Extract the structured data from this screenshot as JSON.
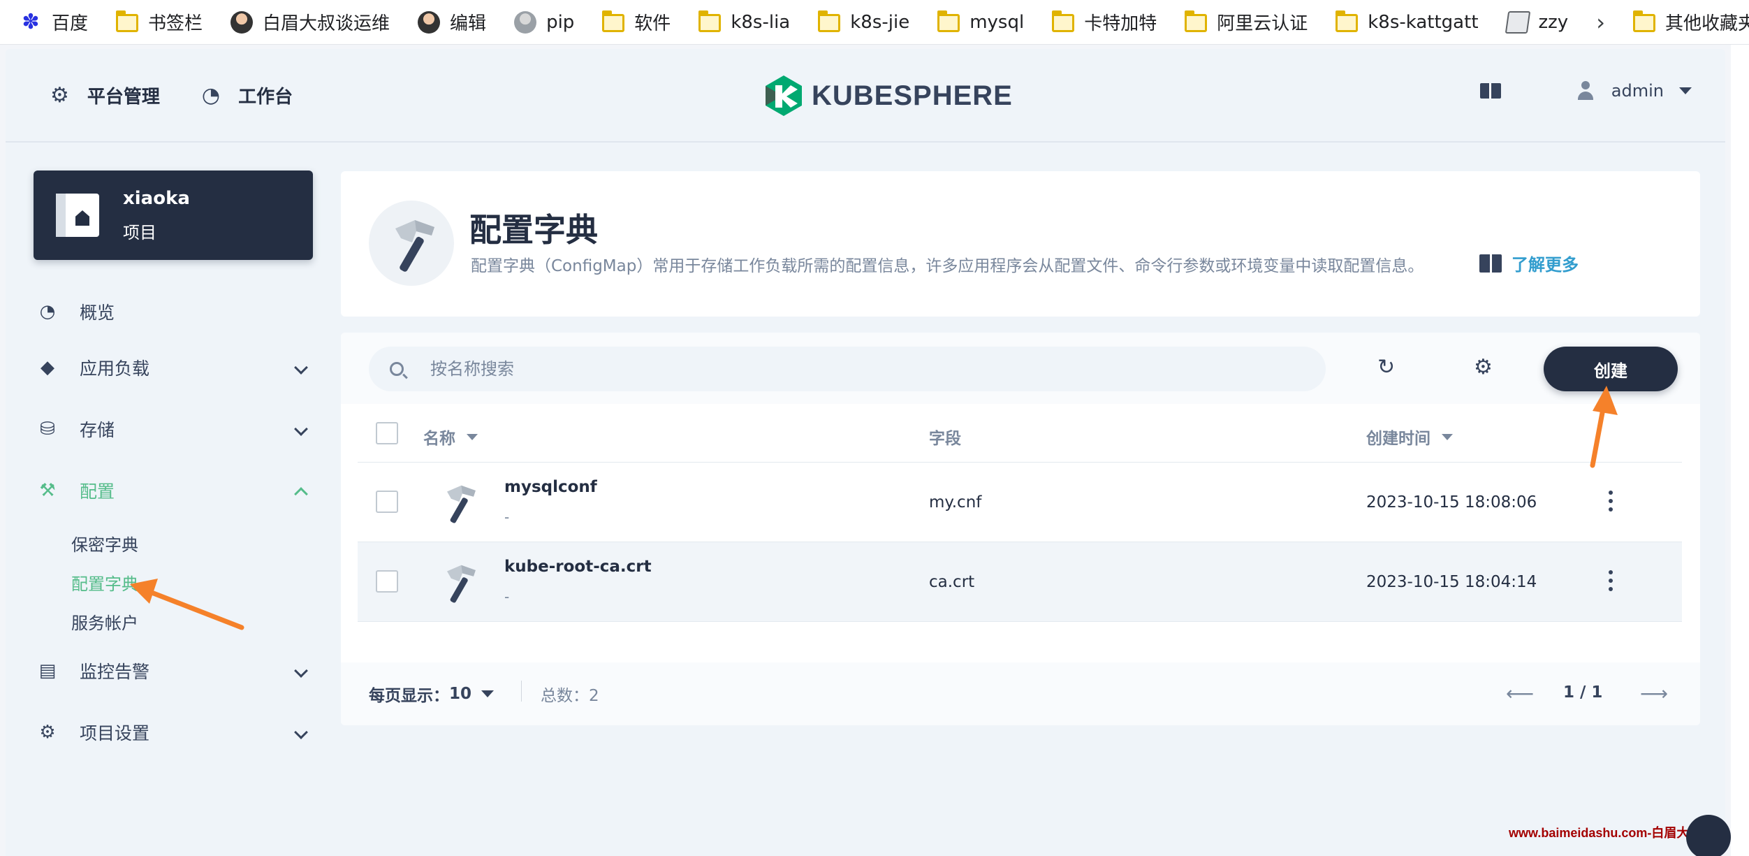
{
  "bookmarks": {
    "items": [
      {
        "label": "百度",
        "icon": "baidu-paw-icon"
      },
      {
        "label": "书签栏",
        "icon": "folder-icon"
      },
      {
        "label": "白眉大叔谈运维",
        "icon": "person-icon"
      },
      {
        "label": "编辑",
        "icon": "person-icon"
      },
      {
        "label": "pip",
        "icon": "person-icon"
      },
      {
        "label": "软件",
        "icon": "folder-icon"
      },
      {
        "label": "k8s-lia",
        "icon": "folder-icon"
      },
      {
        "label": "k8s-jie",
        "icon": "folder-icon"
      },
      {
        "label": "mysql",
        "icon": "folder-icon"
      },
      {
        "label": "卡特加特",
        "icon": "folder-icon"
      },
      {
        "label": "阿里云认证",
        "icon": "folder-icon"
      },
      {
        "label": "k8s-kattgatt",
        "icon": "folder-icon"
      },
      {
        "label": "zzy",
        "icon": "document-icon"
      }
    ],
    "other": "其他收藏夹"
  },
  "topnav": {
    "platform": "平台管理",
    "workbench": "工作台",
    "logo_text": "KUBESPHERE",
    "username": "admin"
  },
  "sidebar": {
    "project_name": "xiaoka",
    "project_type": "项目",
    "items": [
      {
        "label": "概览",
        "icon": "dashboard-icon"
      },
      {
        "label": "应用负载",
        "icon": "layers-icon"
      },
      {
        "label": "存储",
        "icon": "database-icon"
      },
      {
        "label": "配置",
        "icon": "hammer-icon"
      },
      {
        "label": "监控告警",
        "icon": "monitoring-icon"
      },
      {
        "label": "项目设置",
        "icon": "gear-icon"
      }
    ],
    "config_children": [
      "保密字典",
      "配置字典",
      "服务帐户"
    ]
  },
  "banner": {
    "title": "配置字典",
    "description": "配置字典（ConfigMap）常用于存储工作负载所需的配置信息，许多应用程序会从配置文件、命令行参数或环境变量中读取配置信息。",
    "learn_more": "了解更多"
  },
  "toolbar": {
    "search_placeholder": "按名称搜索",
    "create_label": "创建"
  },
  "table": {
    "columns": [
      "名称",
      "字段",
      "创建时间"
    ],
    "rows": [
      {
        "name": "mysqlconf",
        "desc": "-",
        "field": "my.cnf",
        "created": "2023-10-15 18:08:06"
      },
      {
        "name": "kube-root-ca.crt",
        "desc": "-",
        "field": "ca.crt",
        "created": "2023-10-15 18:04:14"
      }
    ]
  },
  "pagination": {
    "per_page_label": "每页显示：",
    "per_page_value": "10",
    "total_label": "总数：",
    "total_value": "2",
    "page": "1 / 1"
  },
  "watermark": "www.baimeidashu.com-白眉大叔",
  "colors": {
    "primary_dark": "#242e42",
    "accent_green": "#55bc8a",
    "link_blue": "#329dce",
    "annotation_orange": "#f5812a",
    "logo_green": "#00a971"
  }
}
